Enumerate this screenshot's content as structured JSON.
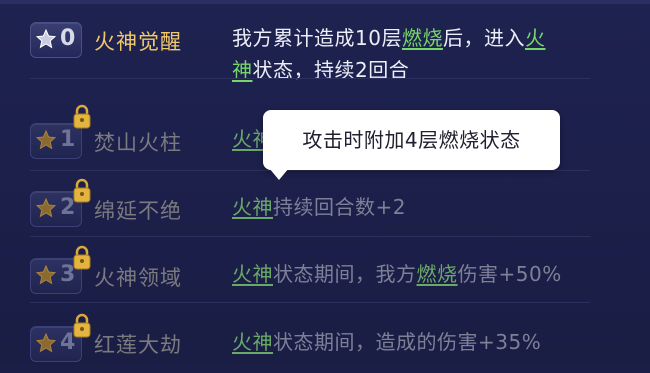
{
  "rows": [
    {
      "level": "0",
      "name": "火神觉醒",
      "locked": false,
      "desc_line1": [
        "我方累计造成10层",
        "燃烧",
        "后，进入",
        "火"
      ],
      "desc_line2": [
        "神",
        "状态，持续2回合"
      ]
    },
    {
      "level": "1",
      "name": "焚山火柱",
      "locked": true,
      "desc": [
        "火神",
        ""
      ]
    },
    {
      "level": "2",
      "name": "绵延不绝",
      "locked": true,
      "desc": [
        "火神",
        "持续回合数+2"
      ]
    },
    {
      "level": "3",
      "name": "火神领域",
      "locked": true,
      "desc": [
        "火神",
        "状态期间，我方",
        "燃烧",
        "伤害+50%"
      ]
    },
    {
      "level": "4",
      "name": "红莲大劫",
      "locked": true,
      "desc": [
        "火神",
        "状态期间，造成的伤害+35%"
      ]
    }
  ],
  "tooltip": {
    "text": "攻击时附加4层燃烧状态"
  },
  "colors": {
    "active_name": "#f2c96a",
    "keyword": "#77d66a",
    "dim_text": "#7d8097",
    "background": "#1b1f47"
  }
}
